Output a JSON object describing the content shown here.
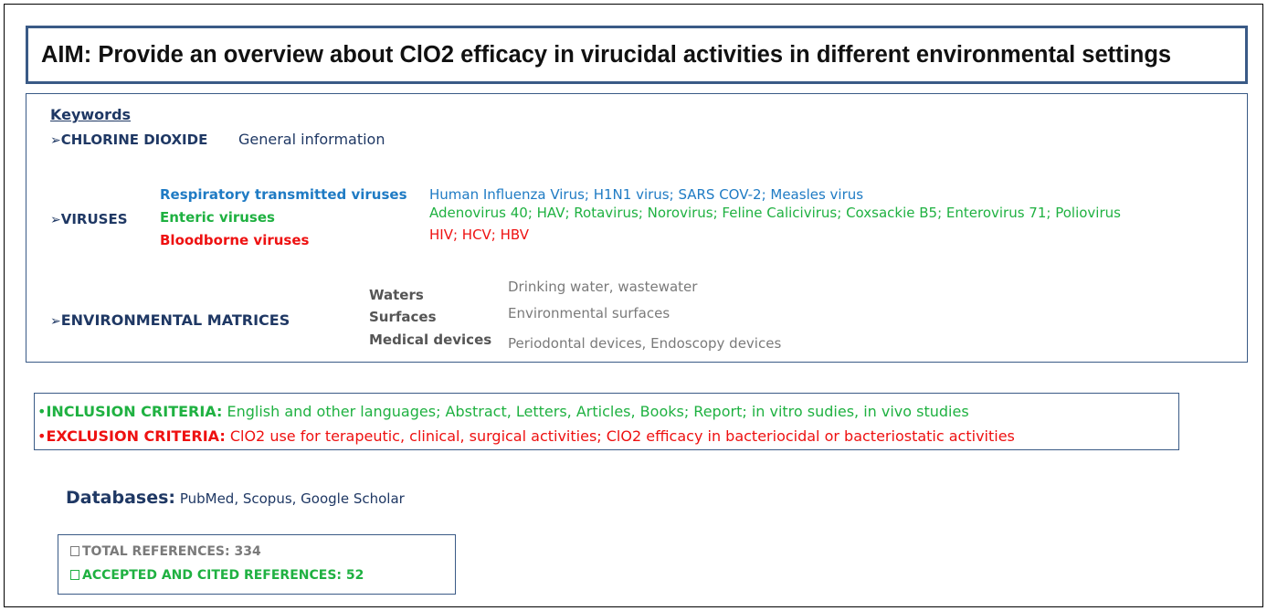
{
  "aim": "AIM: Provide an overview about ClO2 efficacy in virucidal activities in different environmental settings",
  "keywords": {
    "heading": "Keywords",
    "chlorine": {
      "label": "CHLORINE DIOXIDE",
      "desc": "General information"
    },
    "viruses": {
      "label": "VIRUSES",
      "groups": [
        {
          "name": "Respiratory transmitted viruses",
          "examples": "Human Influenza Virus; H1N1 virus; SARS COV-2; Measles virus",
          "color": "#1f7bc4"
        },
        {
          "name": "Enteric viruses",
          "examples": "Adenovirus 40; HAV; Rotavirus; Norovirus; Feline Calicivirus; Coxsackie B5; Enterovirus 71;  Poliovirus",
          "color": "#1fb141"
        },
        {
          "name": "Bloodborne viruses",
          "examples": "HIV; HCV; HBV",
          "color": "#ee1111"
        }
      ]
    },
    "environmental": {
      "label": "ENVIRONMENTAL MATRICES",
      "matrices": [
        {
          "name": "Waters",
          "desc": "Drinking water, wastewater"
        },
        {
          "name": "Surfaces",
          "desc": "Environmental surfaces"
        },
        {
          "name": "Medical devices",
          "desc": "Periodontal devices, Endoscopy devices"
        }
      ]
    }
  },
  "criteria": {
    "inclusion_label": "INCLUSION CRITERIA:",
    "inclusion_text": "English and other languages; Abstract, Letters, Articles, Books;  Report; in vitro sudies,  in vivo studies",
    "exclusion_label": "EXCLUSION CRITERIA:",
    "exclusion_text": "ClO2 use for terapeutic, clinical, surgical activities; ClO2 efficacy in bacteriocidal or bacteriostatic activities"
  },
  "databases": {
    "label": "Databases:",
    "list": "PubMed, Scopus,  Google Scholar"
  },
  "references": {
    "total": "TOTAL REFERENCES: 334",
    "accepted": "ACCEPTED AND CITED REFERENCES: 52"
  }
}
